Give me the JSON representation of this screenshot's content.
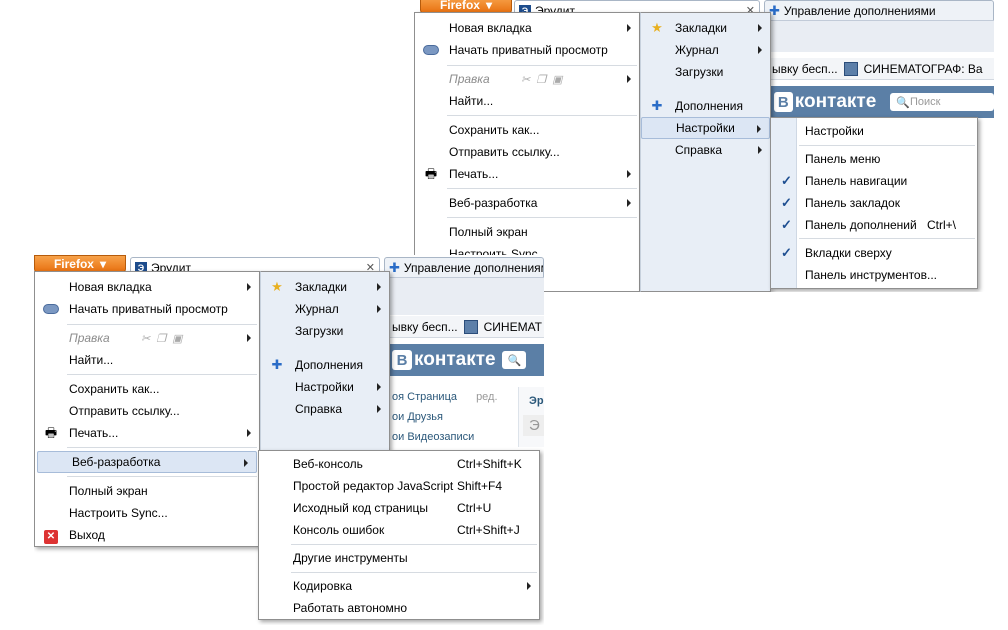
{
  "firefox_button": "Firefox",
  "tabs": {
    "erudit": "Эрудит",
    "addons": "Управление дополнениями"
  },
  "bookmarks": {
    "item1": "ывку бесп...",
    "item2_full": "СИНЕМАТОГРАФ: Ва",
    "item2_short": "СИНЕМАТ"
  },
  "vk": {
    "logo_letter": "В",
    "logo_text": "контакте",
    "search": "Поиск",
    "links": [
      "оя Страница",
      "ред.",
      "ои Друзья",
      "ои Видеозаписи"
    ],
    "side": [
      "Эр",
      "Э"
    ]
  },
  "main_menu_left": [
    {
      "label": "Новая вкладка",
      "arrow": true
    },
    {
      "label": "Начать приватный просмотр",
      "icon": "mask-icon"
    },
    {
      "label": "Правка",
      "disabled": true,
      "arrow": true
    },
    {
      "label": "Найти..."
    },
    {
      "label": "Сохранить как..."
    },
    {
      "label": "Отправить ссылку..."
    },
    {
      "label": "Печать...",
      "icon": "printer-icon",
      "arrow": true
    },
    {
      "label": "Веб-разработка",
      "arrow": true
    },
    {
      "label": "Полный экран"
    },
    {
      "label": "Настроить Sync..."
    },
    {
      "label": "Выход",
      "icon": "exit-icon"
    }
  ],
  "main_menu_right": [
    {
      "label": "Закладки",
      "icon": "star-icon",
      "arrow": true
    },
    {
      "label": "Журнал",
      "arrow": true
    },
    {
      "label": "Загрузки"
    },
    {
      "label": "Дополнения",
      "icon": "puzzle-icon"
    },
    {
      "label": "Настройки",
      "arrow": true
    },
    {
      "label": "Справка",
      "arrow": true
    }
  ],
  "top_cut_item": "Настроить Sync",
  "settings_submenu": [
    {
      "label": "Настройки"
    },
    {
      "label": "Панель меню",
      "checked": false
    },
    {
      "label": "Панель навигации",
      "checked": true
    },
    {
      "label": "Панель закладок",
      "checked": true
    },
    {
      "label": "Панель дополнений",
      "checked": true,
      "shortcut": "Ctrl+\\"
    },
    {
      "label": "Вкладки сверху",
      "checked": true
    },
    {
      "label": "Панель инструментов..."
    }
  ],
  "webdev_submenu": [
    {
      "label": "Веб-консоль",
      "shortcut": "Ctrl+Shift+K"
    },
    {
      "label": "Простой редактор JavaScript",
      "shortcut": "Shift+F4"
    },
    {
      "label": "Исходный код страницы",
      "shortcut": "Ctrl+U"
    },
    {
      "label": "Консоль ошибок",
      "shortcut": "Ctrl+Shift+J"
    },
    {
      "label": "Другие инструменты"
    },
    {
      "label": "Кодировка",
      "arrow": true
    },
    {
      "label": "Работать автономно"
    }
  ],
  "colors": {
    "firefox_orange": "#e8700f",
    "menu_highlight": "#dce6f4",
    "vk_blue": "#5b7fa6",
    "check_blue": "#1e4f91"
  }
}
